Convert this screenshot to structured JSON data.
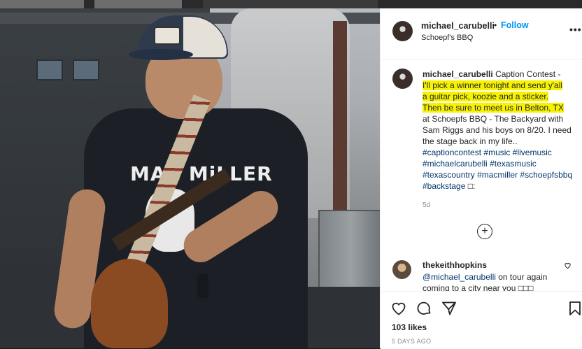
{
  "post": {
    "username": "michael_carubelli",
    "follow_label": "Follow",
    "follow_separator": "•",
    "location": "Schoepf's BBQ",
    "more_label": "•••"
  },
  "caption": {
    "username": "michael_carubelli",
    "lead": "Caption Contest -",
    "highlight_1": "I'll pick a winner tonight and send y'all",
    "highlight_2": "a guitar pick, koozie and a sticker.",
    "highlight_3": "Then be sure to meet us in Belton, TX",
    "body": "at Schoepfs BBQ - The Backyard with Sam Riggs and his boys on 8/20. I need the stage back in my life..",
    "hashtags": [
      "#captioncontest",
      "#music",
      "#livemusic",
      "#michaelcarubelli",
      "#texasmusic",
      "#texascountry",
      "#macmiller",
      "#schoepfsbbq",
      "#backstage"
    ],
    "trailing_glyph": "□:",
    "time_ago": "5d"
  },
  "load_more": "+",
  "comment": {
    "username": "thekeithhopkins",
    "mention": "@michael_carubelli",
    "text": "on tour again coming to a city near you □□□"
  },
  "actions": {
    "icons": [
      "heart-icon",
      "comment-icon",
      "share-icon",
      "bookmark-icon"
    ],
    "likes": "103 likes",
    "date": "5 DAYS AGO"
  },
  "photo": {
    "shirt_print": "MAC MiLLER"
  },
  "colors": {
    "link": "#0095f6",
    "hashtag": "#00376b",
    "highlight": "#f7f200",
    "text": "#262626",
    "muted": "#8e8e8e"
  }
}
